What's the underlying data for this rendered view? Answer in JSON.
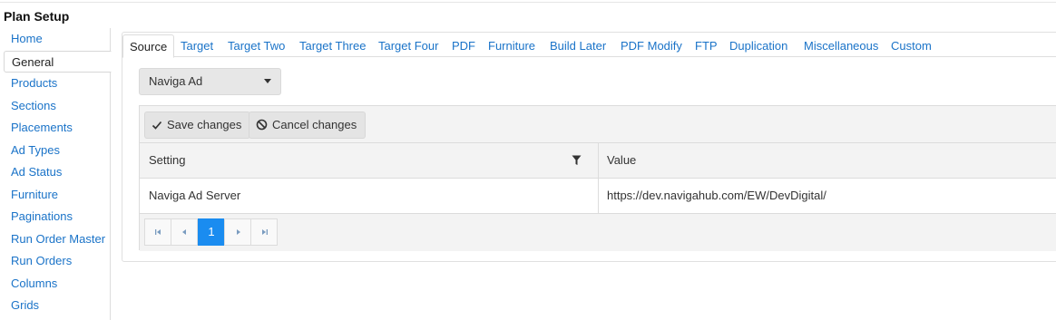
{
  "page": {
    "title": "Plan Setup"
  },
  "sidebar": {
    "items": [
      {
        "label": "Home",
        "active": false
      },
      {
        "label": "General",
        "active": true
      },
      {
        "label": "Products",
        "active": false
      },
      {
        "label": "Sections",
        "active": false
      },
      {
        "label": "Placements",
        "active": false
      },
      {
        "label": "Ad Types",
        "active": false
      },
      {
        "label": "Ad Status",
        "active": false
      },
      {
        "label": "Furniture",
        "active": false
      },
      {
        "label": "Paginations",
        "active": false
      },
      {
        "label": "Run Order Master",
        "active": false
      },
      {
        "label": "Run Orders",
        "active": false
      },
      {
        "label": "Columns",
        "active": false
      },
      {
        "label": "Grids",
        "active": false
      }
    ]
  },
  "tabs": [
    {
      "label": "Source",
      "active": true
    },
    {
      "label": "Target",
      "active": false
    },
    {
      "label": "Target Two",
      "active": false
    },
    {
      "label": "Target Three",
      "active": false
    },
    {
      "label": "Target Four",
      "active": false
    },
    {
      "label": "PDF",
      "active": false
    },
    {
      "label": "Furniture",
      "active": false
    },
    {
      "label": "Build Later",
      "active": false
    },
    {
      "label": "PDF Modify",
      "active": false
    },
    {
      "label": "FTP",
      "active": false
    },
    {
      "label": "Duplication",
      "active": false
    },
    {
      "label": "Miscellaneous",
      "active": false
    },
    {
      "label": "Custom",
      "active": false
    }
  ],
  "source_select": {
    "value": "Naviga Ad"
  },
  "toolbar": {
    "save_label": "Save changes",
    "cancel_label": "Cancel changes"
  },
  "grid": {
    "columns": [
      "Setting",
      "Value"
    ],
    "rows": [
      {
        "setting": "Naviga Ad Server",
        "value": "https://dev.navigahub.com/EW/DevDigital/"
      }
    ]
  },
  "pager": {
    "current_page": "1"
  },
  "colors": {
    "link": "#1a73c8",
    "accent": "#1a8cf0"
  }
}
